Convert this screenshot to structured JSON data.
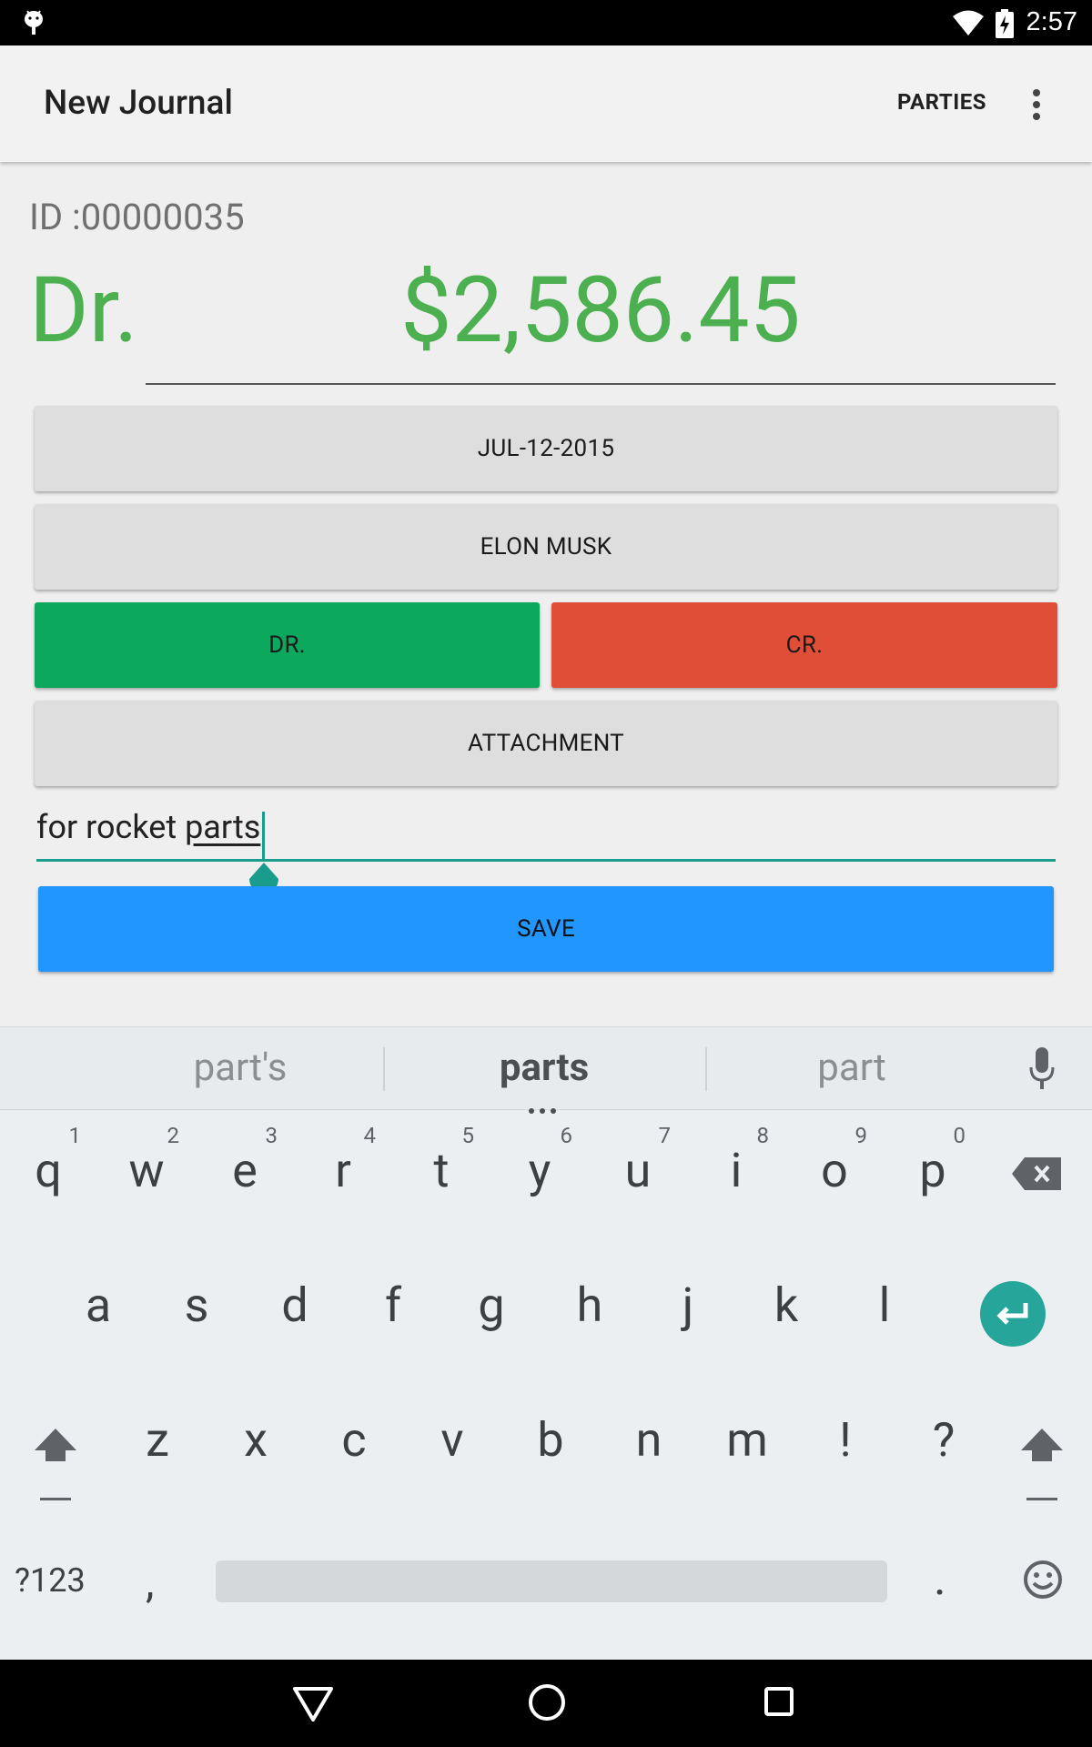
{
  "status_bar": {
    "time": "2:57"
  },
  "app_bar": {
    "title": "New Journal",
    "parties_label": "PARTIES"
  },
  "entry": {
    "id_text": "ID :00000035",
    "type_label": "Dr.",
    "amount": "$2,586.45",
    "date_button": "JUL-12-2015",
    "party_button": "ELON MUSK",
    "dr_button": "DR.",
    "cr_button": "CR.",
    "attachment_button": "ATTACHMENT",
    "memo_prefix": "for rocket ",
    "memo_word": "parts",
    "save_button": "SAVE"
  },
  "colors": {
    "amount_green": "#4caf50",
    "dr_green": "#0ca85e",
    "cr_red": "#e04e38",
    "save_blue": "#2196ff",
    "accent_teal": "#26a69a"
  },
  "keyboard": {
    "suggestions": [
      "part's",
      "parts",
      "part"
    ],
    "row1": [
      {
        "key": "q",
        "hint": "1"
      },
      {
        "key": "w",
        "hint": "2"
      },
      {
        "key": "e",
        "hint": "3"
      },
      {
        "key": "r",
        "hint": "4"
      },
      {
        "key": "t",
        "hint": "5"
      },
      {
        "key": "y",
        "hint": "6"
      },
      {
        "key": "u",
        "hint": "7"
      },
      {
        "key": "i",
        "hint": "8"
      },
      {
        "key": "o",
        "hint": "9"
      },
      {
        "key": "p",
        "hint": "0"
      }
    ],
    "row2": [
      "a",
      "s",
      "d",
      "f",
      "g",
      "h",
      "j",
      "k",
      "l"
    ],
    "row3": [
      "z",
      "x",
      "c",
      "v",
      "b",
      "n",
      "m",
      "!",
      "?"
    ],
    "symbols_key": "?123",
    "comma_key": ",",
    "period_key": ".",
    "icons": [
      "mic-icon",
      "backspace-icon",
      "enter-icon",
      "shift-icon",
      "emoji-icon"
    ]
  },
  "nav_bar": {
    "icons": [
      "back-icon",
      "home-icon",
      "recents-icon"
    ]
  }
}
